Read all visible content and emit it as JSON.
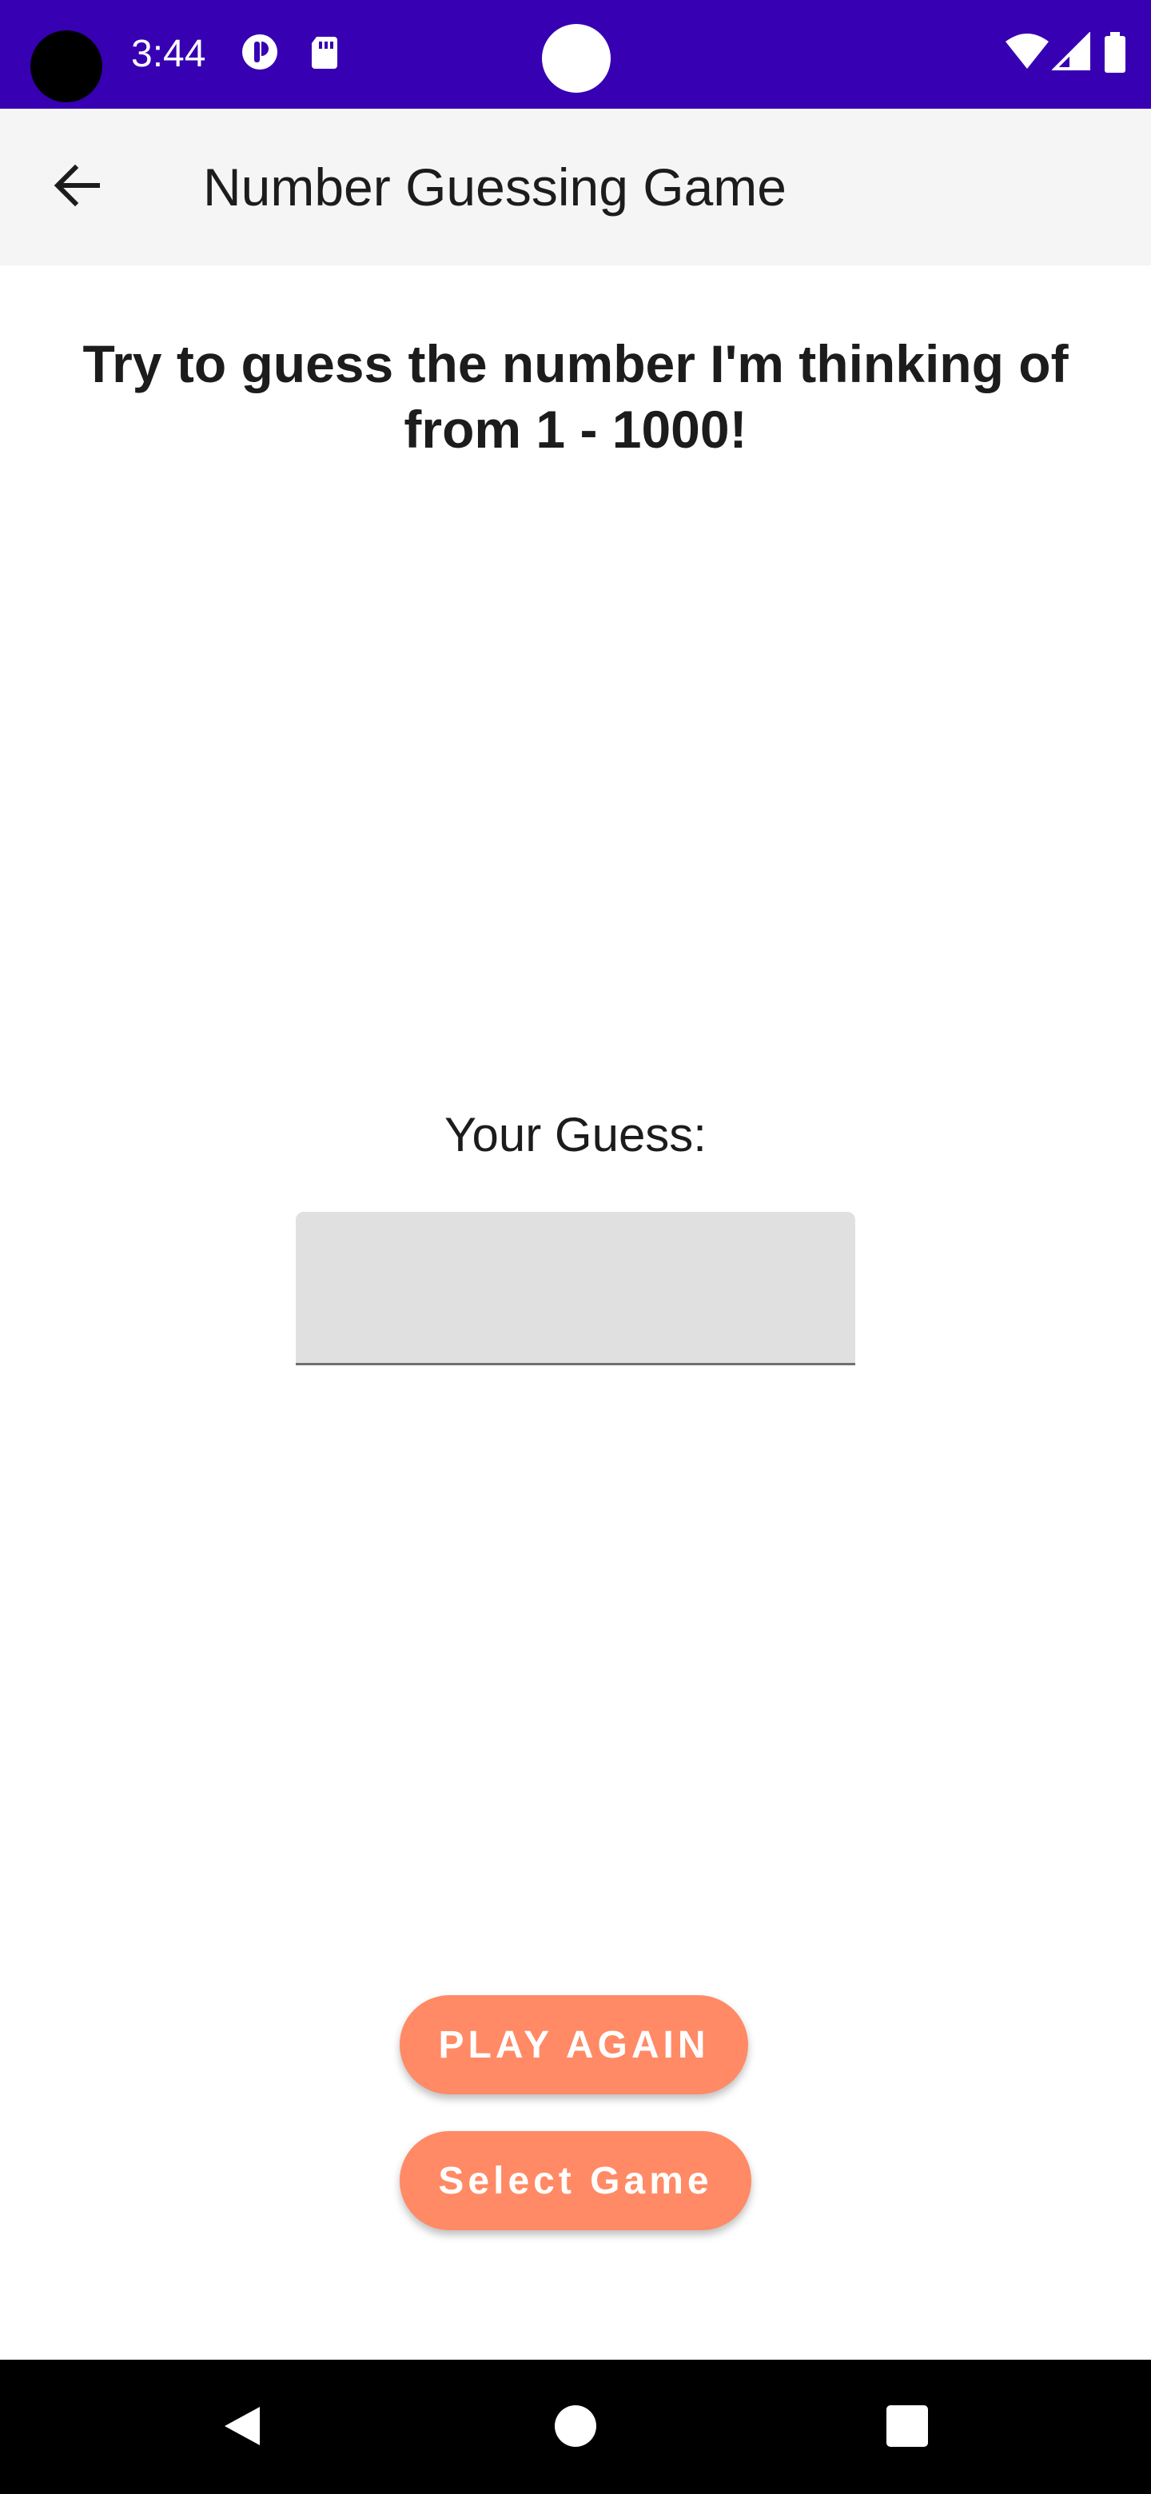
{
  "status_bar": {
    "time": "3:44",
    "background_color": "#3700b3",
    "icons": [
      "notification-app-icon",
      "sd-card-icon",
      "wifi-icon",
      "signal-icon",
      "battery-icon"
    ]
  },
  "app_bar": {
    "title": "Number Guessing Game",
    "back_icon": "arrow-left-icon"
  },
  "content": {
    "instruction": "Try to guess the number I'm thinking of from 1 - 1000!",
    "guess_label": "Your Guess:",
    "guess_input": {
      "value": "",
      "placeholder": ""
    }
  },
  "buttons": {
    "play_again": "PLAY AGAIN",
    "select_game": "Select Game",
    "color": "#ff8a65"
  },
  "nav_bar": {
    "icons": [
      "back-triangle-icon",
      "home-circle-icon",
      "recents-square-icon"
    ]
  }
}
